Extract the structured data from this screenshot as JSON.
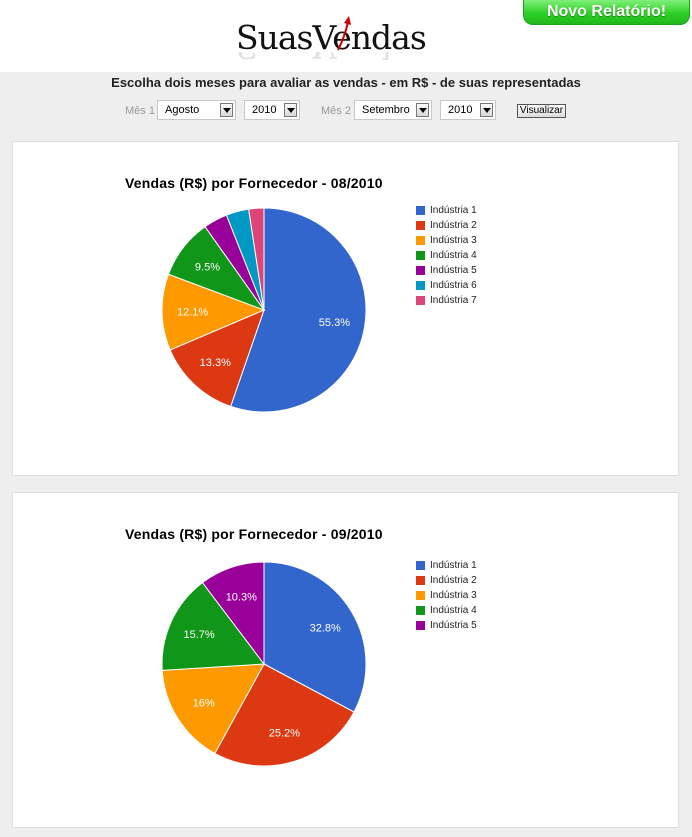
{
  "header": {
    "logo_text": "SuasVendas",
    "new_report_button": "Novo Relatório!"
  },
  "form": {
    "subtitle": "Escolha dois meses para avaliar as vendas - em R$ - de suas representadas",
    "month1_label": "Mês 1",
    "month1_value": "Agosto",
    "year1_value": "2010",
    "month2_label": "Mês 2",
    "month2_value": "Setembro",
    "year2_value": "2010",
    "submit_label": "Visualizar"
  },
  "colors": {
    "industria_1": "#3366cc",
    "industria_2": "#dc3912",
    "industria_3": "#ff9900",
    "industria_4": "#109618",
    "industria_5": "#990099",
    "industria_6": "#0099c6",
    "industria_7": "#dd4477"
  },
  "chart_data": [
    {
      "type": "pie",
      "title": "Vendas (R$) por Fornecedor - 08/2010",
      "legend_position": "right",
      "categories": [
        "Indústria 1",
        "Indústria 2",
        "Indústria 3",
        "Indústria 4",
        "Indústria 5",
        "Indústria 6",
        "Indústria 7"
      ],
      "values": [
        55.3,
        13.3,
        12.1,
        9.5,
        3.8,
        3.6,
        2.4
      ],
      "value_labels": [
        "55.3%",
        "13.3%",
        "12.1%",
        "9.5%",
        "",
        "",
        ""
      ]
    },
    {
      "type": "pie",
      "title": "Vendas (R$) por Fornecedor - 09/2010",
      "legend_position": "right",
      "categories": [
        "Indústria 1",
        "Indústria 2",
        "Indústria 3",
        "Indústria 4",
        "Indústria 5"
      ],
      "values": [
        32.8,
        25.2,
        16.0,
        15.7,
        10.3
      ],
      "value_labels": [
        "32.8%",
        "25.2%",
        "16%",
        "15.7%",
        "10.3%"
      ]
    }
  ]
}
